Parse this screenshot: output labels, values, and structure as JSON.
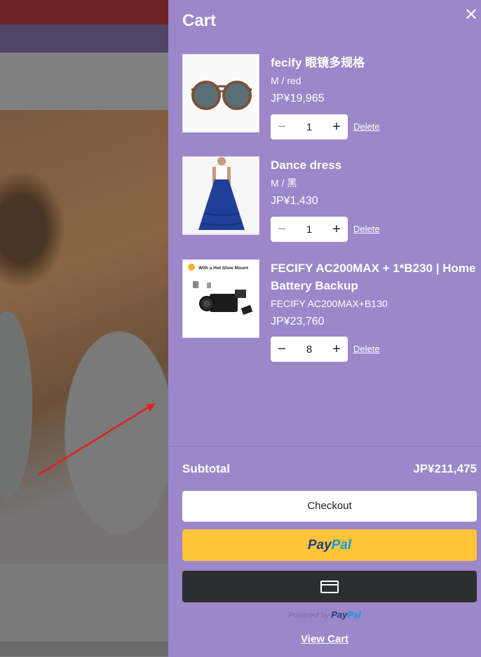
{
  "cart": {
    "title": "Cart",
    "items": [
      {
        "name": "fecify 眼镜多规格",
        "variant": "M / red",
        "price": "JP¥19,965",
        "quantity": "1",
        "delete_label": "Delete",
        "image": "sunglasses"
      },
      {
        "name": "Dance dress",
        "variant": "M / 黑",
        "price": "JP¥1,430",
        "quantity": "1",
        "delete_label": "Delete",
        "image": "blue-maxi-skirt"
      },
      {
        "name": "FECIFY AC200MAX + 1*B230 | Home Battery Backup",
        "variant": "FECIFY AC200MAX+B130",
        "price": "JP¥23,760",
        "quantity": "8",
        "delete_label": "Delete",
        "image": "camcorder",
        "image_caption": "With a Hot Shoe Mount"
      }
    ],
    "subtotal_label": "Subtotal",
    "subtotal_value": "JP¥211,475",
    "checkout_label": "Checkout",
    "paypal_label_pay": "Pay",
    "paypal_label_pal": "Pal",
    "powered_by": "Powered by",
    "view_cart_label": "View Cart"
  },
  "colors": {
    "drawer_bg": "#9b87c9",
    "paypal_yellow": "#ffc43a",
    "card_button": "#2c2e2f"
  }
}
